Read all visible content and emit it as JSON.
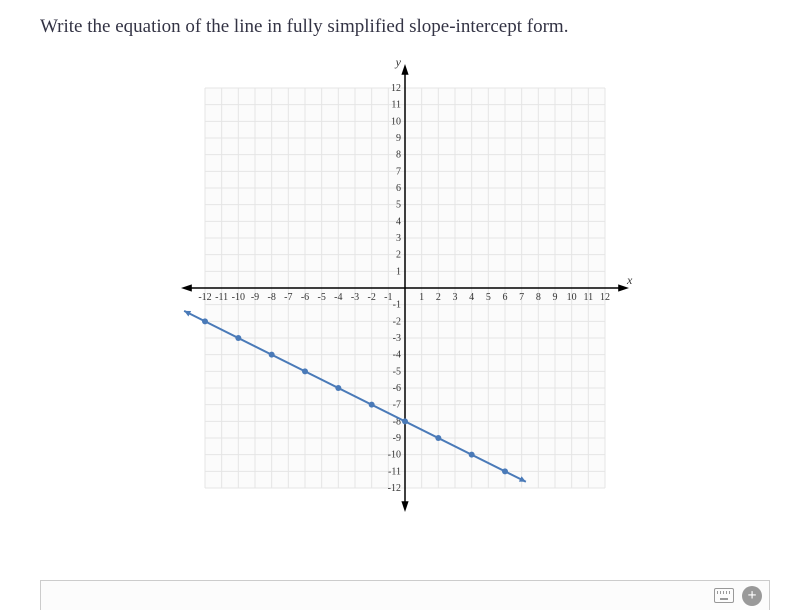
{
  "question": "Write the equation of the line in fully simplified slope-intercept form.",
  "chart_data": {
    "type": "line",
    "title": "",
    "xlabel": "x",
    "ylabel": "y",
    "xlim": [
      -12,
      12
    ],
    "ylim": [
      -12,
      12
    ],
    "x_ticks": [
      -12,
      -11,
      -10,
      -9,
      -8,
      -7,
      -6,
      -5,
      -4,
      -3,
      -2,
      -1,
      1,
      2,
      3,
      4,
      5,
      6,
      7,
      8,
      9,
      10,
      11,
      12
    ],
    "y_ticks": [
      -12,
      -11,
      -10,
      -9,
      -8,
      -7,
      -6,
      -5,
      -4,
      -3,
      -2,
      -1,
      1,
      2,
      3,
      4,
      5,
      6,
      7,
      8,
      9,
      10,
      11,
      12
    ],
    "series": [
      {
        "name": "line",
        "points": [
          {
            "x": -12,
            "y": -2
          },
          {
            "x": -10,
            "y": -3
          },
          {
            "x": -8,
            "y": -4
          },
          {
            "x": -6,
            "y": -5
          },
          {
            "x": -4,
            "y": -6
          },
          {
            "x": -2,
            "y": -7
          },
          {
            "x": 0,
            "y": -8
          },
          {
            "x": 2,
            "y": -9
          },
          {
            "x": 4,
            "y": -10
          },
          {
            "x": 6,
            "y": -11
          }
        ],
        "slope": -0.5,
        "intercept": -8
      }
    ]
  }
}
